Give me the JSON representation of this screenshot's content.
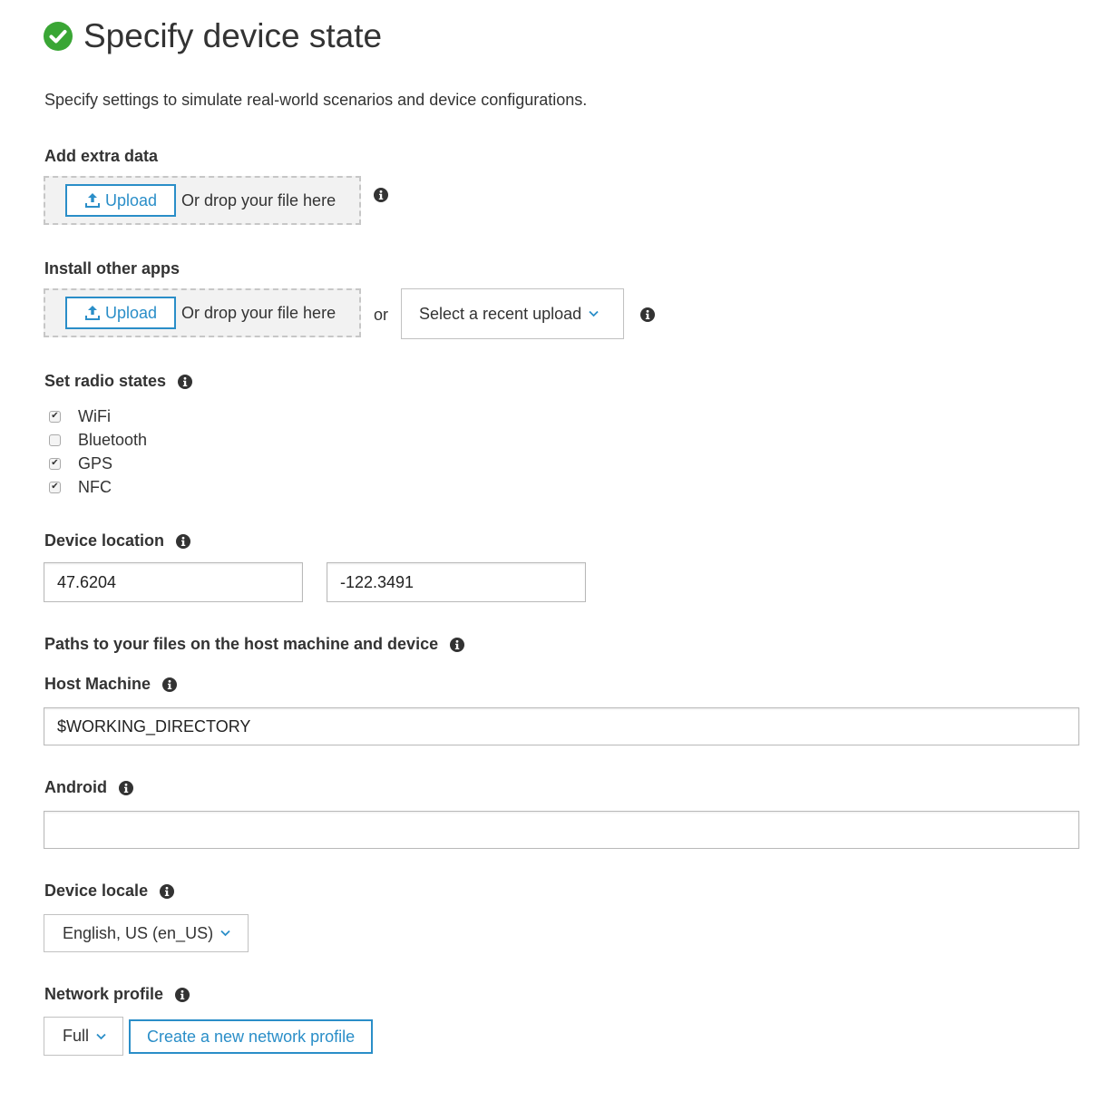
{
  "header": {
    "title": "Specify device state",
    "subtitle": "Specify settings to simulate real-world scenarios and device configurations.",
    "status_icon": "check-circle-icon",
    "status_color": "#3aa635"
  },
  "extra_data": {
    "label": "Add extra data",
    "upload_label": "Upload",
    "drop_text": "Or drop your file here"
  },
  "other_apps": {
    "label": "Install other apps",
    "upload_label": "Upload",
    "drop_text": "Or drop your file here",
    "or_text": "or",
    "recent_select": "Select a recent upload"
  },
  "radio_states": {
    "label": "Set radio states",
    "items": [
      {
        "label": "WiFi",
        "checked": true
      },
      {
        "label": "Bluetooth",
        "checked": false
      },
      {
        "label": "GPS",
        "checked": true
      },
      {
        "label": "NFC",
        "checked": true
      }
    ]
  },
  "location": {
    "label": "Device location",
    "latitude": "47.6204",
    "longitude": "-122.3491"
  },
  "paths": {
    "label": "Paths to your files on the host machine and device",
    "host_label": "Host Machine",
    "host_value": "$WORKING_DIRECTORY",
    "android_label": "Android",
    "android_value": ""
  },
  "locale": {
    "label": "Device locale",
    "selected": "English, US (en_US)"
  },
  "network": {
    "label": "Network profile",
    "selected": "Full",
    "create_label": "Create a new network profile"
  },
  "colors": {
    "accent": "#2a8ec8",
    "text": "#333333"
  }
}
